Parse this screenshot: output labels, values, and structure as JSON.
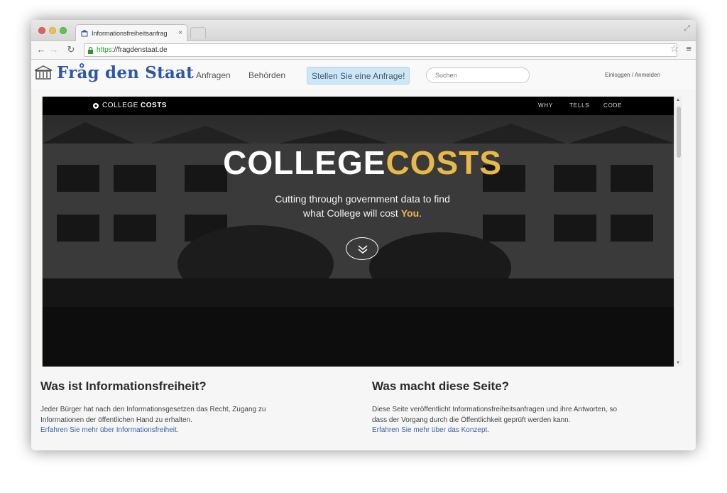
{
  "browser": {
    "tab_title": "Informationsfreiheitsanfrag",
    "tab_close": "×",
    "url_scheme": "https",
    "url_rest": "://fragdenstaat.de"
  },
  "site": {
    "logo": "Fråg den Staat",
    "nav": [
      "Anfragen",
      "Behörden"
    ],
    "cta": "Stellen Sie eine Anfrage!",
    "search_placeholder": "Suchen",
    "login": "Einloggen / Anmelden"
  },
  "embed": {
    "brand_prefix": "COLLEGE",
    "brand_suffix": "COSTS",
    "nav": [
      "WHY",
      "TELLS",
      "CODE"
    ],
    "title_white": "COLLEGE",
    "title_gold": "COSTS",
    "sub_line1": "Cutting through government data to find",
    "sub_line2_pre": "what College will cost ",
    "sub_line2_you": "You",
    "sub_line2_post": "."
  },
  "sections": {
    "left": {
      "title": "Was ist Informationsfreiheit?",
      "text_line1": "Jeder Bürger hat nach den Informationsgesetzen das Recht, Zugang zu",
      "text_line2": "Informationen der öffentlichen Hand zu erhalten.",
      "link": "Erfahren Sie mehr über Informationsfreiheit."
    },
    "right": {
      "title": "Was macht diese Seite?",
      "text_line1": "Diese Seite veröffentlicht Informationsfreiheitsanfragen und ihre Antworten, so",
      "text_line2": "dass der Vorgang durch die Öffentlichkeit geprüft werden kann.",
      "link": "Erfahren Sie mehr über das Konzept."
    }
  },
  "colors": {
    "accent_gold": "#e8b94a",
    "link_blue": "#3464b4",
    "logo_blue": "#2d58a8",
    "cta_bg": "#cfe6f5"
  },
  "icons": [
    "back-arrow-icon",
    "forward-arrow-icon",
    "reload-icon",
    "lock-icon",
    "star-icon",
    "menu-icon",
    "building-icon",
    "chevron-down-icon"
  ]
}
